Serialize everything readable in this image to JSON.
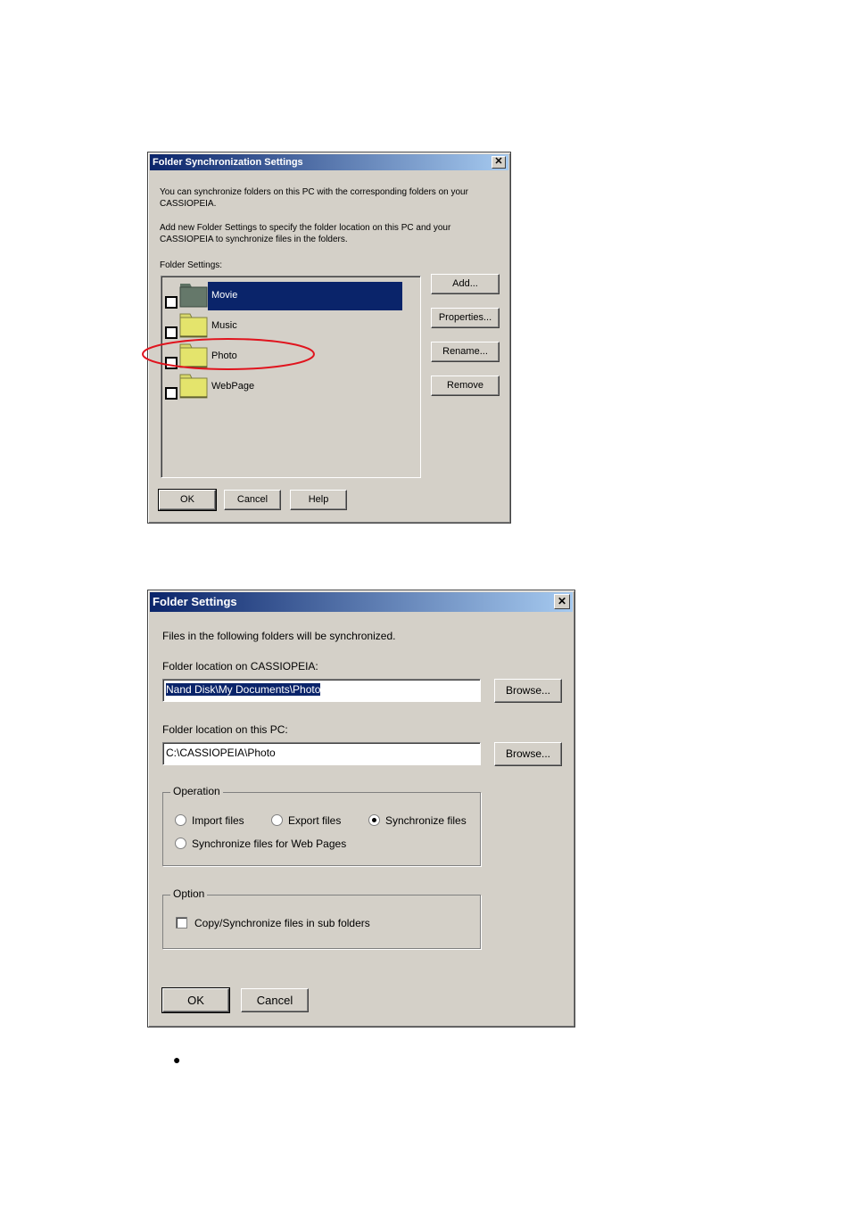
{
  "dialog1": {
    "title": "Folder Synchronization Settings",
    "close_glyph": "✕",
    "intro1": "You can synchronize folders on this PC with the corresponding folders on your\nCASSIOPEIA.",
    "intro2": "Add new Folder Settings to specify the folder location on this PC and your\nCASSIOPEIA to synchronize files in the folders.",
    "list_label": "Folder Settings:",
    "items": [
      {
        "label": "Movie",
        "selected": true,
        "checked": false
      },
      {
        "label": "Music",
        "selected": false,
        "checked": false
      },
      {
        "label": "Photo",
        "selected": false,
        "checked": false
      },
      {
        "label": "WebPage",
        "selected": false,
        "checked": false
      }
    ],
    "buttons": {
      "add": "Add...",
      "properties": "Properties...",
      "rename": "Rename...",
      "remove": "Remove",
      "ok": "OK",
      "cancel": "Cancel",
      "help": "Help"
    }
  },
  "dialog2": {
    "title": "Folder Settings",
    "close_glyph": "✕",
    "intro": "Files in the following folders will be synchronized.",
    "device_label": "Folder location on CASSIOPEIA:",
    "device_path": "Nand Disk\\My Documents\\Photo",
    "pc_label": "Folder location on this PC:",
    "pc_path": "C:\\CASSIOPEIA\\Photo",
    "browse_label": "Browse...",
    "operation": {
      "legend": "Operation",
      "import_label": "Import files",
      "export_label": "Export files",
      "sync_label": "Synchronize files",
      "web_label": "Synchronize files for Web Pages",
      "selected": "Synchronize files"
    },
    "option": {
      "legend": "Option",
      "subfolders_label": "Copy/Synchronize files in sub folders",
      "subfolders_checked": false
    },
    "ok_label": "OK",
    "cancel_label": "Cancel"
  },
  "bullet": "●",
  "colors": {
    "face": "#d4d0c8",
    "title_start": "#0a246a",
    "title_end": "#a6caf0",
    "highlight_ring": "#e0141e",
    "folder": "#e4e46c"
  }
}
